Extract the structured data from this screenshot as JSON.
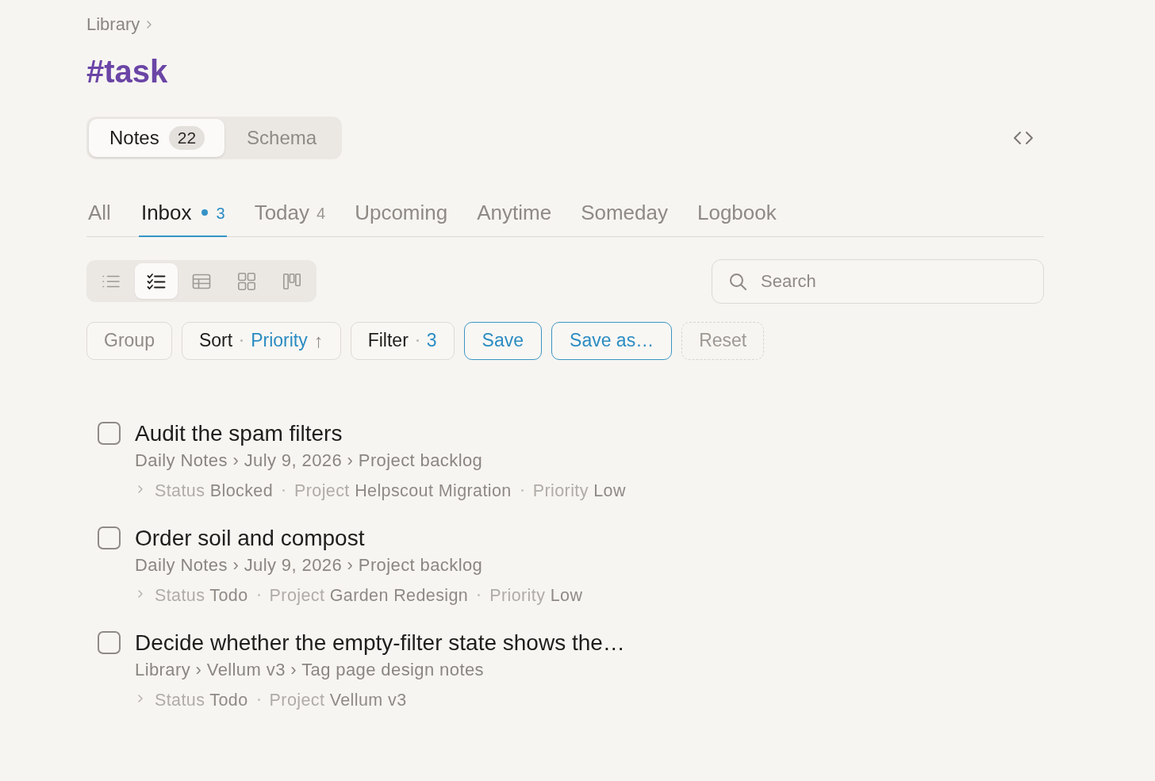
{
  "breadcrumb": [
    "Library"
  ],
  "title": "#task",
  "segments": [
    {
      "label": "Notes",
      "count": "22",
      "selected": true
    },
    {
      "label": "Schema",
      "selected": false
    }
  ],
  "tabs": [
    {
      "label": "All",
      "selected": false,
      "dot": false
    },
    {
      "label": "Inbox",
      "selected": true,
      "dot": true,
      "count": "3"
    },
    {
      "label": "Today",
      "selected": false,
      "dot": false,
      "count": "4"
    },
    {
      "label": "Upcoming",
      "selected": false,
      "dot": false
    },
    {
      "label": "Anytime",
      "selected": false,
      "dot": false
    },
    {
      "label": "Someday",
      "selected": false,
      "dot": false
    },
    {
      "label": "Logbook",
      "selected": false,
      "dot": false
    }
  ],
  "view_modes": [
    {
      "kind": "list",
      "selected": false
    },
    {
      "kind": "checklist",
      "selected": true
    },
    {
      "kind": "table",
      "selected": false
    },
    {
      "kind": "grid",
      "selected": false
    },
    {
      "kind": "board",
      "selected": false
    }
  ],
  "search": {
    "placeholder": "Search"
  },
  "toolbar": [
    {
      "kind": "muted",
      "label": "Group"
    },
    {
      "kind": "field",
      "label": "Sort",
      "value": "Priority",
      "arrow": "↑"
    },
    {
      "kind": "field",
      "label": "Filter",
      "value": "3"
    },
    {
      "kind": "accent",
      "label": "Save"
    },
    {
      "kind": "accent",
      "label": "Save as…"
    },
    {
      "kind": "dashed",
      "label": "Reset"
    }
  ],
  "tasks": [
    {
      "title": "Audit the spam filters",
      "checked": false,
      "path": "Daily Notes › July 9, 2026 › Project backlog",
      "expanded": false,
      "properties": [
        {
          "name": "Status",
          "value": "Blocked"
        },
        {
          "name": "Project",
          "value": "Helpscout Migration"
        },
        {
          "name": "Priority",
          "value": "Low"
        }
      ]
    },
    {
      "title": "Order soil and compost",
      "checked": false,
      "path": "Daily Notes › July 9, 2026 › Project backlog",
      "expanded": false,
      "properties": [
        {
          "name": "Status",
          "value": "Todo"
        },
        {
          "name": "Project",
          "value": "Garden Redesign"
        },
        {
          "name": "Priority",
          "value": "Low"
        }
      ]
    },
    {
      "title": "Decide whether the empty-filter state shows the…",
      "checked": false,
      "path": "Library › Vellum v3 › Tag page design notes",
      "expanded": false,
      "properties": [
        {
          "name": "Status",
          "value": "Todo"
        },
        {
          "name": "Project",
          "value": "Vellum v3"
        }
      ]
    }
  ]
}
